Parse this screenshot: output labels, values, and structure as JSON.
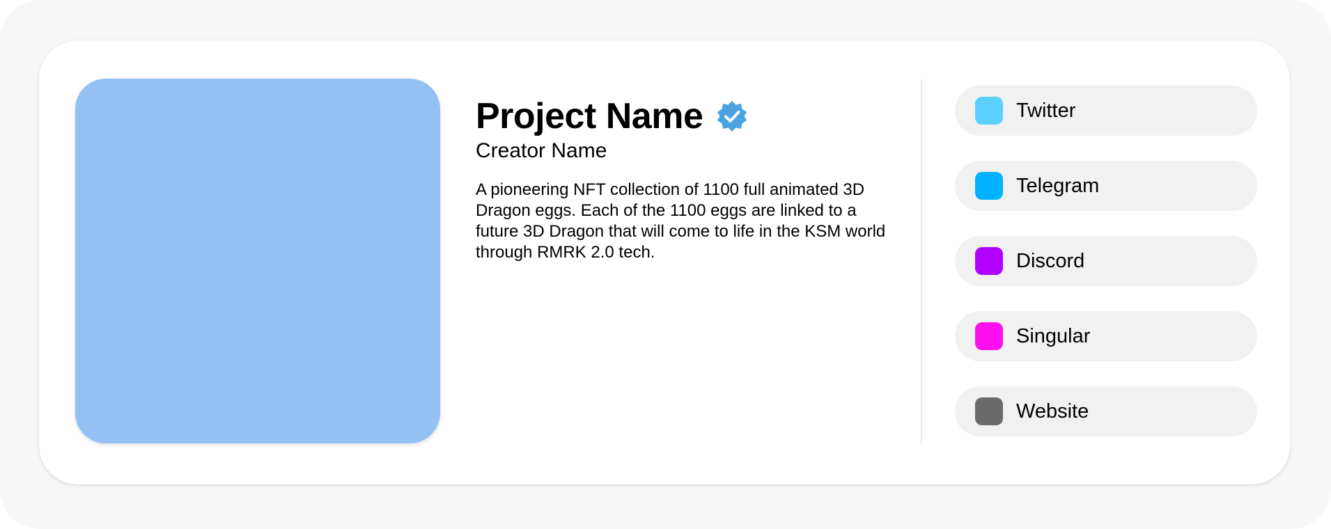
{
  "project": {
    "title": "Project Name",
    "creator": "Creator Name",
    "description": "A pioneering NFT collection of 1100 full animated 3D Dragon eggs. Each of the 1100 eggs are linked to a future 3D Dragon that will come to life in the KSM world through RMRK 2.0 tech.",
    "verified_icon": "verified-badge-icon",
    "image_color": "#94c1f4",
    "badge_color": "#4aa3e0"
  },
  "links": [
    {
      "label": "Twitter",
      "icon": "twitter-icon",
      "color": "#5bd0ff"
    },
    {
      "label": "Telegram",
      "icon": "telegram-icon",
      "color": "#00b2ff"
    },
    {
      "label": "Discord",
      "icon": "discord-icon",
      "color": "#b100ff"
    },
    {
      "label": "Singular",
      "icon": "singular-icon",
      "color": "#ff10ee"
    },
    {
      "label": "Website",
      "icon": "website-icon",
      "color": "#6a6a6a"
    }
  ]
}
